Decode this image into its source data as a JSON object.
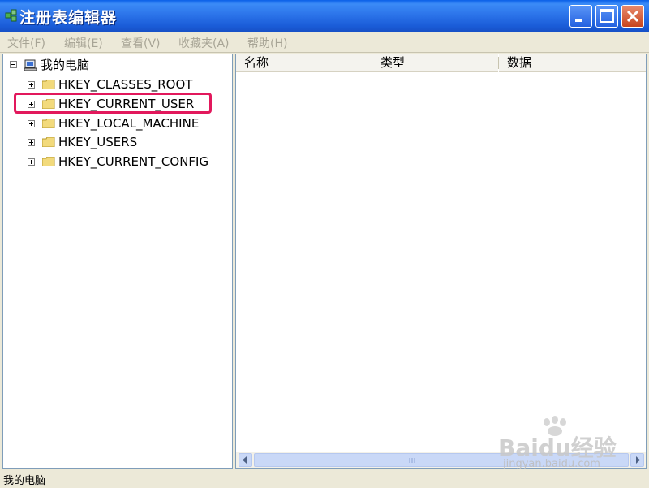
{
  "window": {
    "title": "注册表编辑器"
  },
  "menu": {
    "items": [
      "文件(F)",
      "编辑(E)",
      "查看(V)",
      "收藏夹(A)",
      "帮助(H)"
    ]
  },
  "tree": {
    "root": "我的电脑",
    "items": [
      {
        "label": "HKEY_CLASSES_ROOT",
        "highlighted": false
      },
      {
        "label": "HKEY_CURRENT_USER",
        "highlighted": true
      },
      {
        "label": "HKEY_LOCAL_MACHINE",
        "highlighted": false
      },
      {
        "label": "HKEY_USERS",
        "highlighted": false
      },
      {
        "label": "HKEY_CURRENT_CONFIG",
        "highlighted": false
      }
    ]
  },
  "list": {
    "columns": [
      "名称",
      "类型",
      "数据"
    ]
  },
  "status": {
    "text": "我的电脑"
  },
  "watermark": {
    "main": "Baidu经验",
    "sub": "jingyan.baidu.com"
  },
  "colors": {
    "titlebar": "#2C74EA",
    "highlight": "#E2185C",
    "menu_disabled": "#A8A596"
  }
}
